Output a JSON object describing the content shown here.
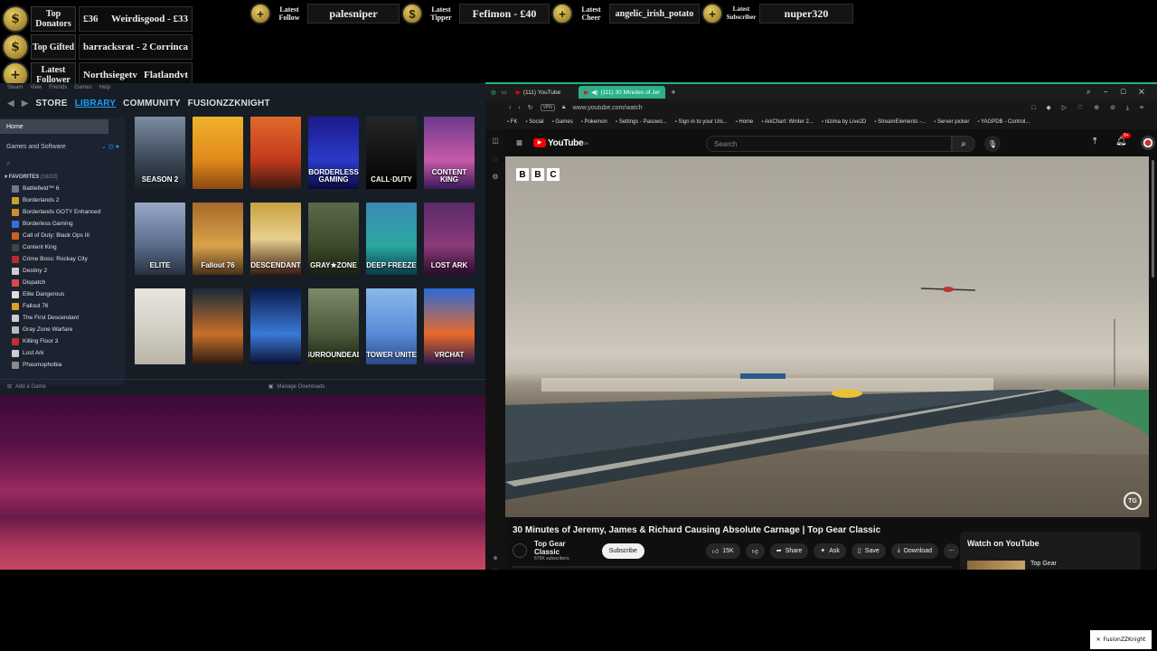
{
  "overlay": {
    "left_rows": [
      {
        "icon": "$",
        "title": "Top Donators",
        "value1": "£36",
        "value2": "Weirdisgood - £33"
      },
      {
        "icon": "$",
        "title": "Top Gifted",
        "value1": "barracksrat - 2",
        "value2": "Corrinca"
      },
      {
        "icon": "+",
        "title": "Latest Follower",
        "value1": "Northsiegetv",
        "value2": "Flatlandvt"
      }
    ],
    "top_items": [
      {
        "icon": "+",
        "label": "Latest Follow",
        "value": "palesniper"
      },
      {
        "icon": "$",
        "label": "Latest Tipper",
        "value": "Fefimon - £40"
      },
      {
        "icon": "+",
        "label": "Latest Cheer",
        "value": "angelic_irish_potato"
      },
      {
        "icon": "+",
        "label": "Latest Subscriber",
        "value": "nuper320"
      }
    ],
    "x_tag": "FusionZZKnight"
  },
  "steam": {
    "menu": [
      "Steam",
      "View",
      "Friends",
      "Games",
      "Help"
    ],
    "tabs": [
      "STORE",
      "LIBRARY",
      "COMMUNITY",
      "FUSIONZZKNIGHT"
    ],
    "active_tab": "LIBRARY",
    "home_label": "Home",
    "filter_label": "Games and Software",
    "favorites_label": "FAVORITES",
    "favorites_count": "(18/22)",
    "games": [
      {
        "name": "Battlefield™ 6",
        "color": "#6b7a8c"
      },
      {
        "name": "Borderlands 2",
        "color": "#c9a227"
      },
      {
        "name": "Borderlands GOTY Enhanced",
        "color": "#d28a2b"
      },
      {
        "name": "Borderless Gaming",
        "color": "#3a6fd8"
      },
      {
        "name": "Call of Duty: Black Ops III",
        "color": "#d0601d"
      },
      {
        "name": "Content King",
        "color": "#444"
      },
      {
        "name": "Crime Boss: Rockay City",
        "color": "#b42d2d"
      },
      {
        "name": "Destiny 2",
        "color": "#ccc"
      },
      {
        "name": "Dispatch",
        "color": "#d84a4a"
      },
      {
        "name": "Elite Dangerous",
        "color": "#ddd"
      },
      {
        "name": "Fallout 76",
        "color": "#e0a020"
      },
      {
        "name": "The First Descendant",
        "color": "#ccc"
      },
      {
        "name": "Gray Zone Warfare",
        "color": "#bbb"
      },
      {
        "name": "Killing Floor 3",
        "color": "#c03030"
      },
      {
        "name": "Lost Ark",
        "color": "#ccc"
      },
      {
        "name": "Phasmophobia",
        "color": "#8a8a8a"
      }
    ],
    "tiles": [
      {
        "label": "SEASON 2",
        "bg": "linear-gradient(180deg,#7b8da3,#3b4856 60%,#1a2028)"
      },
      {
        "label": "",
        "bg": "linear-gradient(180deg,#f0b22a,#e08a1c 60%,#8b4a12)"
      },
      {
        "label": "",
        "bg": "linear-gradient(180deg,#e06a2a,#c23a1c 60%,#3b1a10)"
      },
      {
        "label": "BORDERLESS GAMING",
        "bg": "linear-gradient(180deg,#1a1a8a,#2a3ac8 60%,#0a0a40)"
      },
      {
        "label": "CALL·DUTY",
        "bg": "linear-gradient(180deg,#262626,#111 60%,#000)"
      },
      {
        "label": "CONTENT KING",
        "bg": "linear-gradient(180deg,#6a3a8a,#c85aa8 60%,#3a1a5a)"
      },
      {
        "label": "ELITE",
        "bg": "linear-gradient(180deg,#9aa8c8,#5a6a8a 60%,#2a3040)"
      },
      {
        "label": "Fallout 76",
        "bg": "linear-gradient(180deg,#a86a2a,#d8a24a 60%,#4a3018)"
      },
      {
        "label": "DESCENDANT",
        "bg": "linear-gradient(180deg,#c8a040,#e8d090 50%,#3a1a10)"
      },
      {
        "label": "GRAY★ZONE",
        "bg": "linear-gradient(180deg,#5a6a4a,#3a4a2a 60%,#1a2010)"
      },
      {
        "label": "DEEP FREEZE",
        "bg": "linear-gradient(180deg,#3a8ab8,#2aa8a0 60%,#0a3a4a)"
      },
      {
        "label": "LOST ARK",
        "bg": "linear-gradient(180deg,#5a2a6a,#8a3a7a 60%,#2a0a2a)"
      },
      {
        "label": "",
        "bg": "linear-gradient(180deg,#e8e4dc,#d0ccc2 60%,#b8b2a6)"
      },
      {
        "label": "",
        "bg": "linear-gradient(180deg,#1a2a3a,#c8702a 60%,#2a1a10)"
      },
      {
        "label": "",
        "bg": "linear-gradient(180deg,#0a1a4a,#3a7ad8 60%,#0a1030)"
      },
      {
        "label": "SURROUNDEAD",
        "bg": "linear-gradient(180deg,#7a8a6a,#4a5a3a 60%,#1a2010)"
      },
      {
        "label": "TOWER UNITE",
        "bg": "linear-gradient(180deg,#8ab8e8,#5a8ad8 60%,#2a4a8a)"
      },
      {
        "label": "VRCHAT",
        "bg": "linear-gradient(180deg,#2a6ad8,#e86a2a 60%,#2a1a4a)"
      }
    ],
    "add_game": "Add a Game",
    "manage_downloads": "Manage Downloads"
  },
  "browser": {
    "tabs": [
      {
        "label": "(111) YouTube"
      },
      {
        "label": "(111) 30 Minutes of Jer"
      }
    ],
    "new_tab": "+",
    "url": "www.youtube.com/watch",
    "vpn": "VPN",
    "bookmarks": [
      "FK",
      "Social",
      "Games",
      "Pokemon",
      "Settings - Passwo...",
      "Sign in to your Uni...",
      "Home",
      "AniChart: Winter 2...",
      "nizima by Live2D",
      "StreamElements -...",
      "Server picker",
      "YAGPDB - Control..."
    ],
    "notif_count": "9+"
  },
  "youtube": {
    "logo": "YouTube",
    "country": "GB",
    "search_placeholder": "Search",
    "bbc": [
      "B",
      "B",
      "C"
    ],
    "watermark": "TG",
    "title": "30 Minutes of Jeremy, James & Richard Causing Absolute Carnage | Top Gear Classic",
    "channel": "Top Gear Classic",
    "subscribers": "676K subscribers",
    "subscribe": "Subscribe",
    "likes": "15K",
    "share": "Share",
    "ask": "Ask",
    "save": "Save",
    "download": "Download",
    "watch_on": "Watch on YouTube",
    "related": "Top Gear"
  }
}
